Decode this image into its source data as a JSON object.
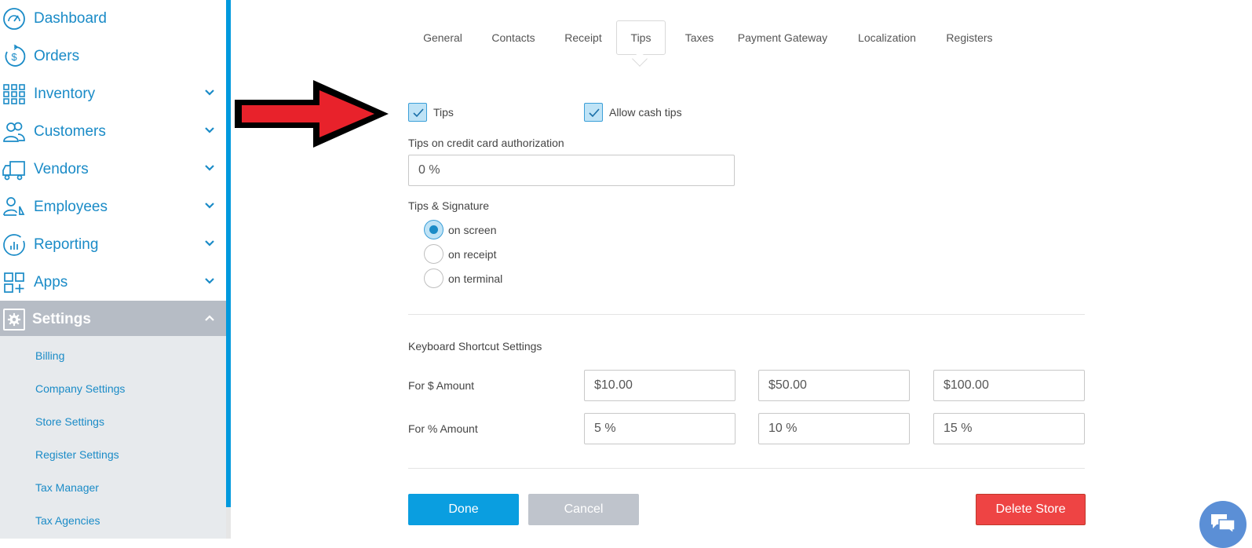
{
  "sidebar": {
    "items": [
      {
        "label": "Dashboard",
        "icon": "dashboard-gauge-icon"
      },
      {
        "label": "Orders",
        "icon": "dollar-refresh-icon"
      },
      {
        "label": "Inventory",
        "icon": "grid-icon"
      },
      {
        "label": "Customers",
        "icon": "users-icon"
      },
      {
        "label": "Vendors",
        "icon": "truck-icon"
      },
      {
        "label": "Employees",
        "icon": "employee-icon"
      },
      {
        "label": "Reporting",
        "icon": "chart-circle-icon"
      },
      {
        "label": "Apps",
        "icon": "apps-icon"
      },
      {
        "label": "Settings",
        "icon": "gear-icon"
      }
    ],
    "settings_subitems": [
      "Billing",
      "Company Settings",
      "Store Settings",
      "Register Settings",
      "Tax Manager",
      "Tax Agencies"
    ]
  },
  "tabs": [
    "General",
    "Contacts",
    "Receipt",
    "Tips",
    "Taxes",
    "Payment Gateway",
    "Localization",
    "Registers"
  ],
  "active_tab": "Tips",
  "form": {
    "tips_label": "Tips",
    "tips_checked": true,
    "allow_cash_label": "Allow cash tips",
    "allow_cash_checked": true,
    "cc_auth_label": "Tips on credit card authorization",
    "cc_auth_value": "0 %",
    "signature_label": "Tips & Signature",
    "signature_options": [
      "on screen",
      "on receipt",
      "on terminal"
    ],
    "signature_selected": "on screen",
    "shortcut_title": "Keyboard Shortcut Settings",
    "dollar_label": "For $ Amount",
    "dollar_values": [
      "$10.00",
      "$50.00",
      "$100.00"
    ],
    "percent_label": "For % Amount",
    "percent_values": [
      "5 %",
      "10 %",
      "15 %"
    ]
  },
  "buttons": {
    "done": "Done",
    "cancel": "Cancel",
    "delete": "Delete Store"
  },
  "colors": {
    "accent": "#1a8bc7",
    "primary_button": "#0a9ee0",
    "danger_button": "#ee4444",
    "arrow_fill": "#e8222b"
  }
}
